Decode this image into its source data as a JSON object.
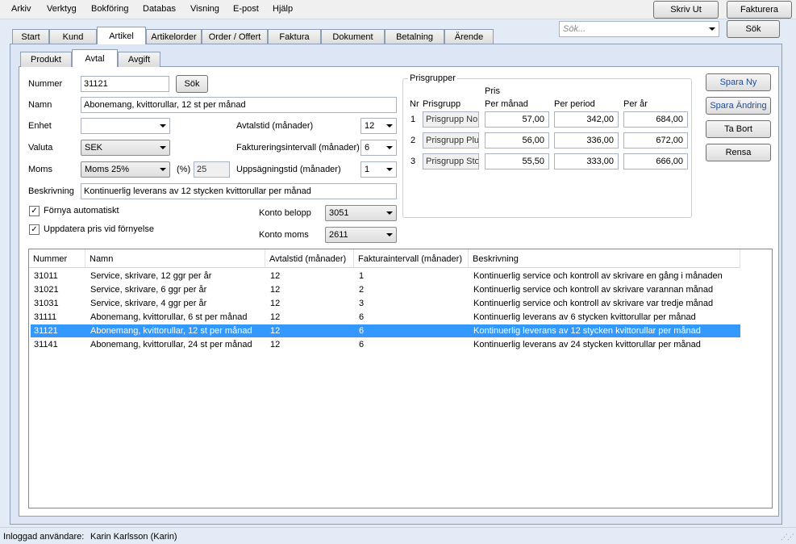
{
  "menu": [
    "Arkiv",
    "Verktyg",
    "Bokföring",
    "Databas",
    "Visning",
    "E-post",
    "Hjälp"
  ],
  "toolbar": {
    "skriv_ut": "Skriv Ut",
    "fakturera": "Fakturera",
    "search_placeholder": "Sök...",
    "search_button": "Sök"
  },
  "main_tabs": [
    "Start",
    "Kund",
    "Artikel",
    "Artikelorder",
    "Order / Offert",
    "Faktura",
    "Dokument",
    "Betalning",
    "Ärende"
  ],
  "sub_tabs": [
    "Produkt",
    "Avtal",
    "Avgift"
  ],
  "form": {
    "nummer_label": "Nummer",
    "nummer_value": "31121",
    "sok_button": "Sök",
    "namn_label": "Namn",
    "namn_value": "Abonemang, kvittorullar, 12 st per månad",
    "enhet_label": "Enhet",
    "enhet_value": "",
    "valuta_label": "Valuta",
    "valuta_value": "SEK",
    "moms_label": "Moms",
    "moms_value": "Moms 25%",
    "moms_pct_label": "(%)",
    "moms_pct_value": "25",
    "avtalstid_label": "Avtalstid (månader)",
    "avtalstid_value": "12",
    "faktureringsintervall_label": "Faktureringsintervall (månader)",
    "faktureringsintervall_value": "6",
    "uppsagningstid_label": "Uppsägningstid (månader)",
    "uppsagningstid_value": "1",
    "beskrivning_label": "Beskrivning",
    "beskrivning_value": "Kontinuerlig leverans av 12 stycken kvittorullar per månad",
    "fornya_label": "Förnya automatiskt",
    "uppdatera_label": "Uppdatera pris vid förnyelse",
    "konto_belopp_label": "Konto belopp",
    "konto_belopp_value": "3051",
    "konto_moms_label": "Konto moms",
    "konto_moms_value": "2611"
  },
  "prisgrupper": {
    "title": "Prisgrupper",
    "headers": {
      "nr": "Nr",
      "grupp": "Prisgrupp",
      "pris_top": "Pris",
      "manad": "Per månad",
      "period": "Per period",
      "ar": "Per år"
    },
    "rows": [
      {
        "nr": "1",
        "grupp": "Prisgrupp Normal",
        "manad": "57,00",
        "period": "342,00",
        "ar": "684,00"
      },
      {
        "nr": "2",
        "grupp": "Prisgrupp Plus",
        "manad": "56,00",
        "period": "336,00",
        "ar": "672,00"
      },
      {
        "nr": "3",
        "grupp": "Prisgrupp Stor",
        "manad": "55,50",
        "period": "333,00",
        "ar": "666,00"
      }
    ]
  },
  "side_buttons": {
    "spara_ny": "Spara Ny",
    "spara_andring": "Spara Ändring",
    "ta_bort": "Ta Bort",
    "rensa": "Rensa"
  },
  "list": {
    "columns": [
      "Nummer",
      "Namn",
      "Avtalstid (månader)",
      "Fakturaintervall (månader)",
      "Beskrivning"
    ],
    "rows": [
      [
        "31011",
        "Service, skrivare, 12 ggr per år",
        "12",
        "1",
        "Kontinuerlig service och kontroll av skrivare en gång i månaden"
      ],
      [
        "31021",
        "Service, skrivare, 6 ggr per år",
        "12",
        "2",
        "Kontinuerlig service och kontroll av skrivare varannan månad"
      ],
      [
        "31031",
        "Service, skrivare, 4 ggr per år",
        "12",
        "3",
        "Kontinuerlig service och kontroll av skrivare var tredje månad"
      ],
      [
        "31111",
        "Abonemang, kvittorullar, 6 st per månad",
        "12",
        "6",
        "Kontinuerlig leverans av 6 stycken kvittorullar per månad"
      ],
      [
        "31121",
        "Abonemang, kvittorullar, 12 st per månad",
        "12",
        "6",
        "Kontinuerlig leverans av 12 stycken kvittorullar per månad"
      ],
      [
        "31141",
        "Abonemang, kvittorullar, 24 st per månad",
        "12",
        "6",
        "Kontinuerlig leverans av 24 stycken kvittorullar per månad"
      ]
    ],
    "selected_number": "31121"
  },
  "status": {
    "label": "Inloggad användare:",
    "user": "Karin Karlsson (Karin)"
  },
  "colors": {
    "selection": "#3399ff",
    "background": "#e3ebf6",
    "accent_text": "#1c4e9c"
  }
}
